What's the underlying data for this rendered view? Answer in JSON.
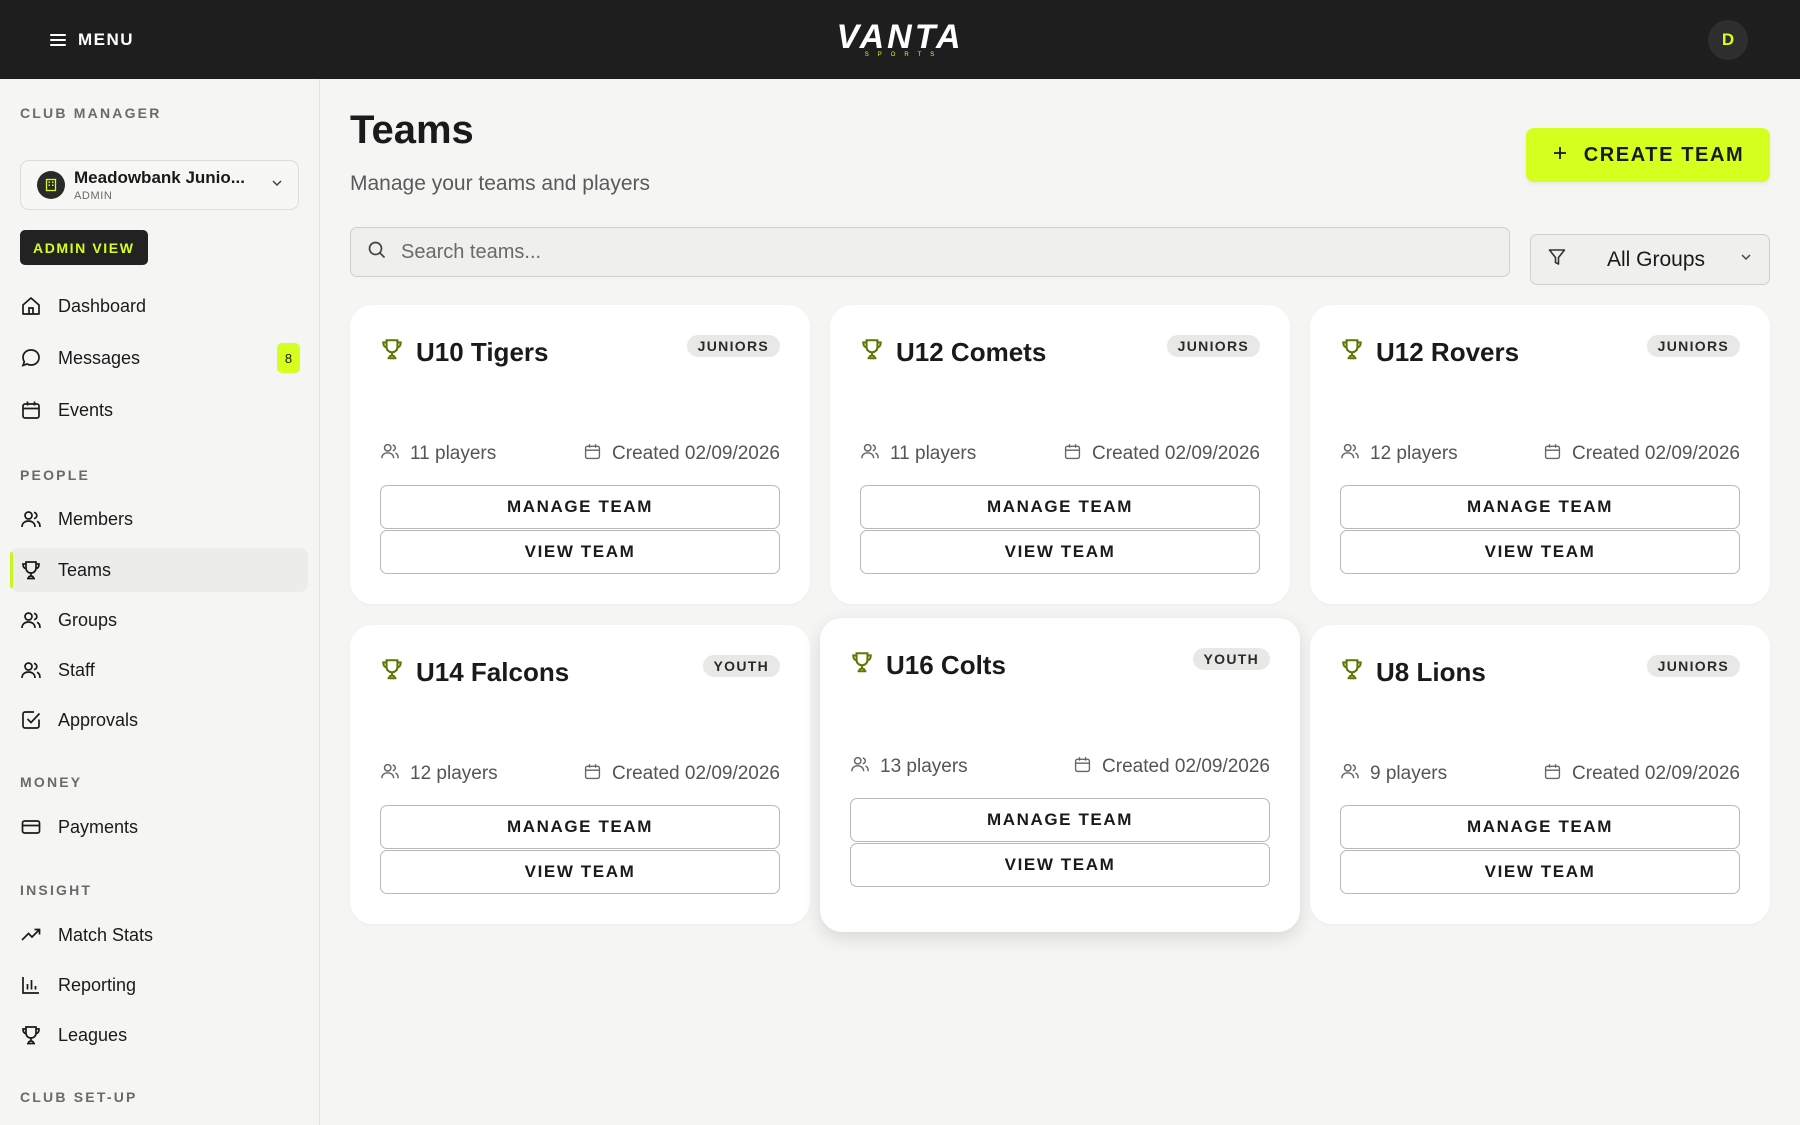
{
  "topbar": {
    "menu_label": "MENU",
    "logo_text": "VANTA",
    "logo_sub": "SPORTS",
    "avatar_initial": "D"
  },
  "sidebar": {
    "section_club": "CLUB MANAGER",
    "club": {
      "name": "Meadowbank Junio...",
      "role": "ADMIN"
    },
    "admin_view_label": "ADMIN VIEW",
    "main_items": [
      {
        "label": "Dashboard",
        "icon": "home-icon"
      },
      {
        "label": "Messages",
        "icon": "chat-icon",
        "badge": "8"
      },
      {
        "label": "Events",
        "icon": "calendar-icon"
      }
    ],
    "section_people": "PEOPLE",
    "people_items": [
      {
        "label": "Members",
        "icon": "users-icon"
      },
      {
        "label": "Teams",
        "icon": "trophy-icon",
        "active": true
      },
      {
        "label": "Groups",
        "icon": "users-icon"
      },
      {
        "label": "Staff",
        "icon": "users-icon"
      },
      {
        "label": "Approvals",
        "icon": "check-square-icon"
      }
    ],
    "section_money": "MONEY",
    "money_items": [
      {
        "label": "Payments",
        "icon": "credit-card-icon"
      }
    ],
    "section_insight": "INSIGHT",
    "insight_items": [
      {
        "label": "Match Stats",
        "icon": "trending-up-icon"
      },
      {
        "label": "Reporting",
        "icon": "bar-chart-icon"
      },
      {
        "label": "Leagues",
        "icon": "trophy-icon"
      }
    ],
    "section_setup": "CLUB SET-UP"
  },
  "main": {
    "title": "Teams",
    "subtitle": "Manage your teams and players",
    "create_label": "CREATE TEAM",
    "search_placeholder": "Search teams...",
    "filter_label": "All Groups",
    "manage_label": "MANAGE TEAM",
    "view_label": "VIEW TEAM",
    "teams": [
      {
        "name": "U10 Tigers",
        "group": "JUNIORS",
        "players": "11 players",
        "created": "Created 02/09/2026"
      },
      {
        "name": "U12 Comets",
        "group": "JUNIORS",
        "players": "11 players",
        "created": "Created 02/09/2026"
      },
      {
        "name": "U12 Rovers",
        "group": "JUNIORS",
        "players": "12 players",
        "created": "Created 02/09/2026"
      },
      {
        "name": "U14 Falcons",
        "group": "YOUTH",
        "players": "12 players",
        "created": "Created 02/09/2026"
      },
      {
        "name": "U16 Colts",
        "group": "YOUTH",
        "players": "13 players",
        "created": "Created 02/09/2026"
      },
      {
        "name": "U8 Lions",
        "group": "JUNIORS",
        "players": "9 players",
        "created": "Created 02/09/2026"
      }
    ]
  },
  "colors": {
    "accent": "#d4ff1f",
    "topbar": "#1e1e1e",
    "background": "#f5f5f3"
  }
}
